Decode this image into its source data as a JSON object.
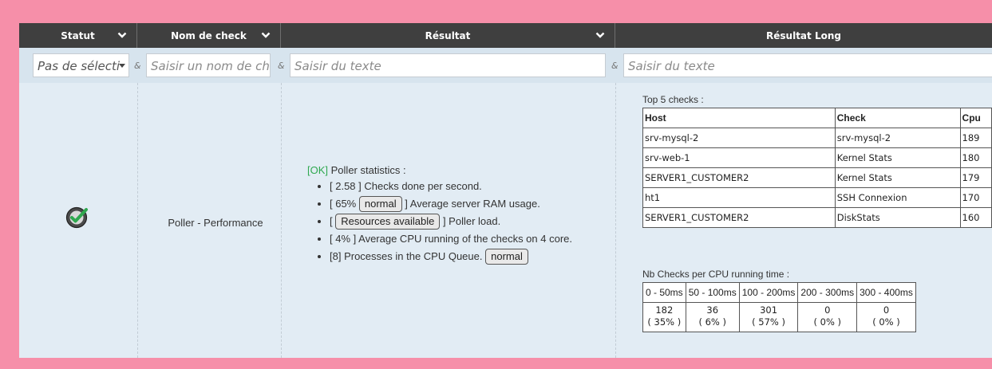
{
  "columns": {
    "statut": "Statut",
    "nom": "Nom de check",
    "resultat": "Résultat",
    "resultat_long": "Résultat Long"
  },
  "filters": {
    "statut_value": "Pas de sélecti",
    "nom_placeholder": "Saisir un nom de che",
    "resultat_placeholder": "Saisir du texte",
    "long_placeholder": "Saisir du texte",
    "amp": "&"
  },
  "row": {
    "status_icon": "check-circle-icon",
    "check_name": "Poller - Performance",
    "result": {
      "ok_tag": "[OK]",
      "title": "Poller statistics :",
      "items": [
        {
          "prefix": "[ 2.58 ] Checks done per second.",
          "pill": "",
          "suffix": ""
        },
        {
          "prefix": "[ 65%",
          "pill": "normal",
          "suffix": "] Average server RAM usage."
        },
        {
          "prefix": "[",
          "pill": "Resources available",
          "suffix": "] Poller load."
        },
        {
          "prefix": "[ 4% ] Average CPU running of the checks on 4 core.",
          "pill": "",
          "suffix": ""
        },
        {
          "prefix": "[8] Processes in the CPU Queue.",
          "pill": "normal",
          "suffix": ""
        }
      ]
    },
    "long": {
      "top5_caption": "Top 5 checks :",
      "top5_headers": [
        "Host",
        "Check",
        "Cpu"
      ],
      "top5_rows": [
        [
          "srv-mysql-2",
          "srv-mysql-2",
          "189"
        ],
        [
          "srv-web-1",
          "Kernel Stats",
          "180"
        ],
        [
          "SERVER1_CUSTOMER2",
          "Kernel Stats",
          "179"
        ],
        [
          "ht1",
          "SSH Connexion",
          "170"
        ],
        [
          "SERVER1_CUSTOMER2",
          "DiskStats",
          "160"
        ]
      ],
      "nb_caption": "Nb Checks per CPU running time :",
      "nb_headers": [
        "0 - 50ms",
        "50 - 100ms",
        "100 - 200ms",
        "200 - 300ms",
        "300 - 400ms"
      ],
      "nb_counts": [
        "182",
        "36",
        "301",
        "0",
        "0"
      ],
      "nb_pcts": [
        "( 35% )",
        "( 6% )",
        "( 57% )",
        "( 0% )",
        "( 0% )"
      ]
    }
  },
  "colors": {
    "ok": "#2fa84f",
    "header_bg": "#3f3f3f",
    "frame": "#f68fa9"
  }
}
